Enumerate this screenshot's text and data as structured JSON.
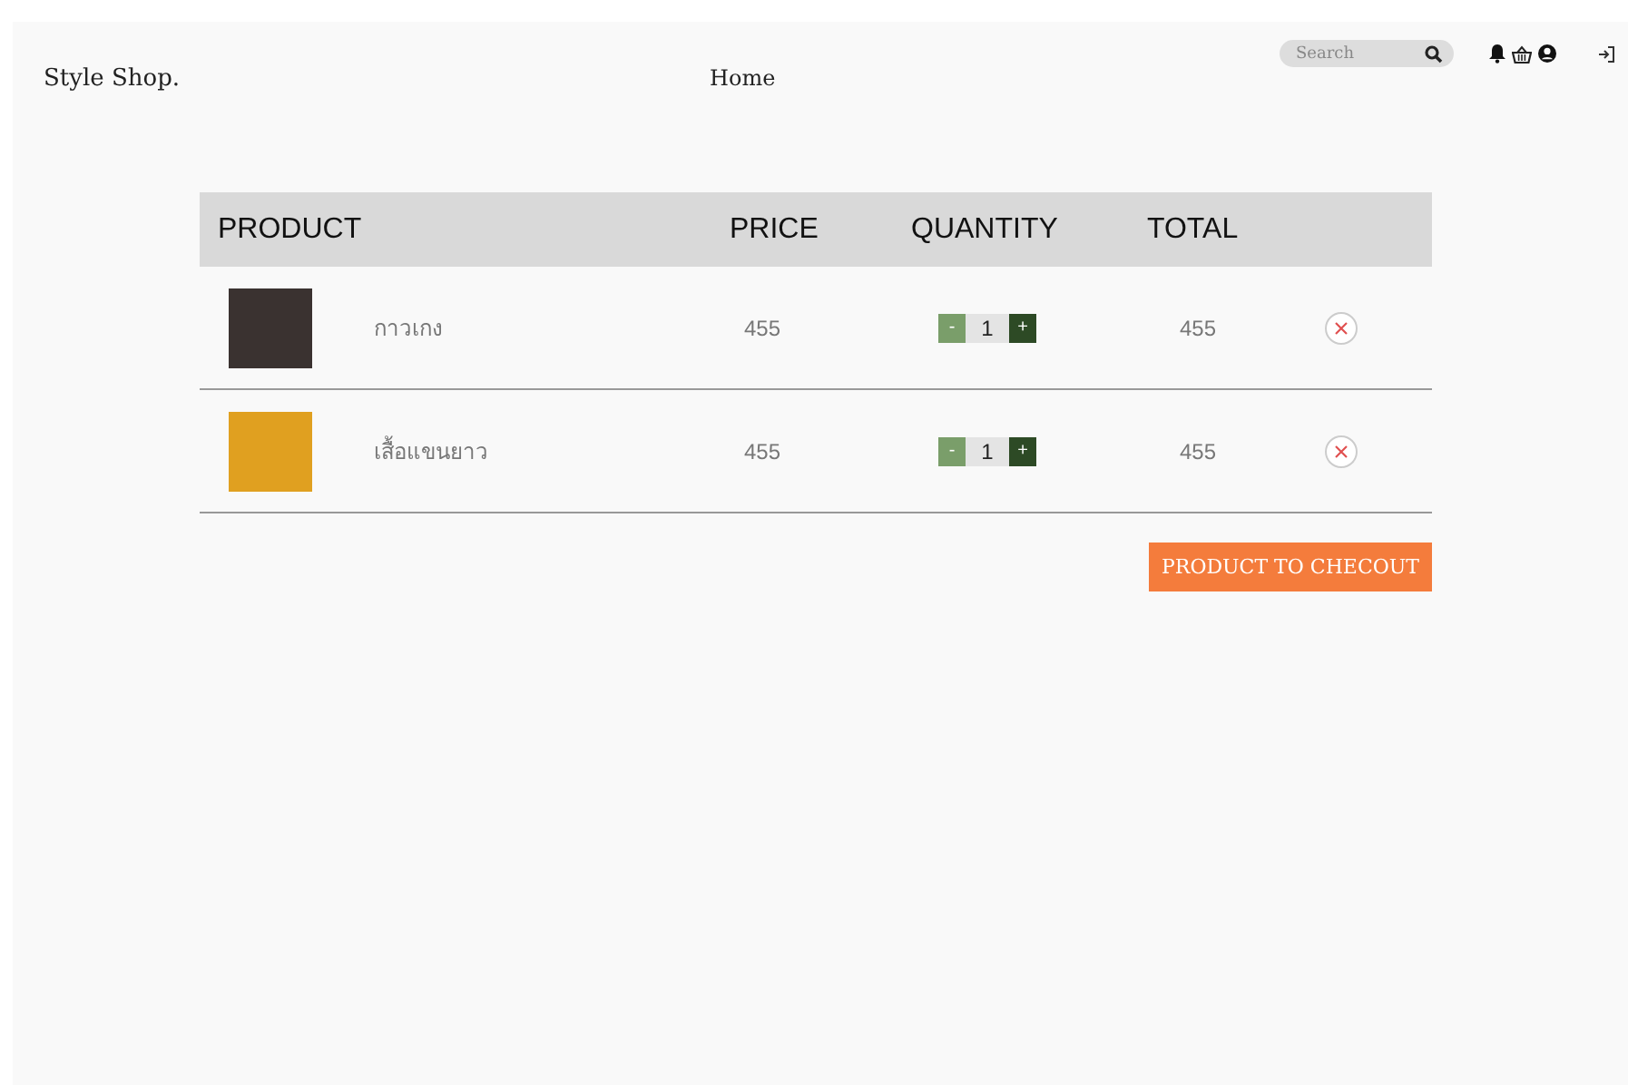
{
  "header": {
    "brand": "Style Shop.",
    "nav": "Home",
    "search": {
      "placeholder": "Search"
    }
  },
  "table": {
    "columns": [
      "PRODUCT",
      "PRICE",
      "QUANTITY",
      "TOTAL"
    ],
    "rows": [
      {
        "name": "กาวเกง",
        "price": "455",
        "quantity": "1",
        "minus": "-",
        "plus": "+",
        "total": "455"
      },
      {
        "name": "เสื้อแขนยาว",
        "price": "455",
        "quantity": "1",
        "minus": "-",
        "plus": "+",
        "total": "455"
      }
    ]
  },
  "checkout_button": "PRODUCT TO CHECOUT"
}
